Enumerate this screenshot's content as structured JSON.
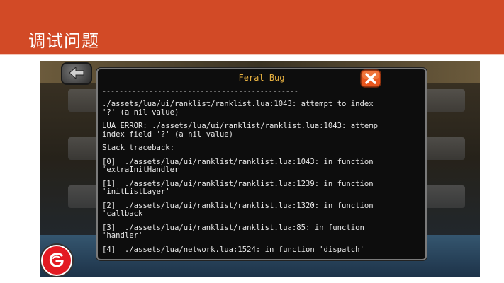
{
  "slide": {
    "title": "调试问题"
  },
  "dialog": {
    "title": "Feral Bug",
    "divider": "----------------------------------------------",
    "close_icon": "close-icon",
    "log_lines": [
      "./assets/lua/ui/ranklist/ranklist.lua:1043: attempt to index\n'?' (a nil value)",
      "LUA ERROR: ./assets/lua/ui/ranklist/ranklist.lua:1043: attemp\nindex field '?' (a nil value)",
      "Stack traceback:",
      "[0]  ./assets/lua/ui/ranklist/ranklist.lua:1043: in function\n'extraInitHandler'",
      "[1]  ./assets/lua/ui/ranklist/ranklist.lua:1239: in function\n'initListLayer'",
      "[2]  ./assets/lua/ui/ranklist/ranklist.lua:1320: in function\n'callback'",
      "[3]  ./assets/lua/ui/ranklist/ranklist.lua:85: in function\n'handler'",
      "[4]  ./assets/lua/network.lua:1524: in function 'dispatch'"
    ]
  },
  "colors": {
    "header": "#d24a26",
    "dialog_title": "#e6b040",
    "close_button": "#e8561e"
  }
}
